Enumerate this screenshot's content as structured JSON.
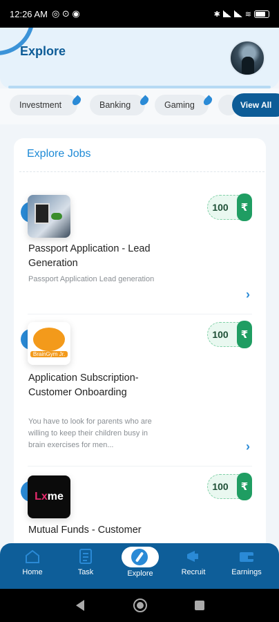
{
  "status": {
    "time": "12:26 AM"
  },
  "header": {
    "title": "Explore"
  },
  "categories": {
    "items": [
      {
        "label": "Investment"
      },
      {
        "label": "Banking"
      },
      {
        "label": "Gaming"
      }
    ],
    "view_all": "View All"
  },
  "jobs": {
    "title": "Explore Jobs",
    "items": [
      {
        "title": "Passport Application - Lead Generation",
        "description": "Passport Application Lead generation",
        "amount": "100",
        "currency": "₹"
      },
      {
        "title": "Application Subscription-Customer Onboarding",
        "description": "You have to look for parents who are willing to keep their children busy in brain exercises for men...",
        "amount": "100",
        "currency": "₹"
      },
      {
        "title": "Mutual Funds - Customer",
        "description": "",
        "amount": "100",
        "currency": "₹"
      }
    ],
    "logo_texts": {
      "brain": "BrainGym Jr.",
      "lxme_left": "L",
      "lxme_x": "x",
      "lxme_right": "me"
    }
  },
  "nav": {
    "items": [
      {
        "label": "Home"
      },
      {
        "label": "Task"
      },
      {
        "label": "Explore"
      },
      {
        "label": "Recruit"
      },
      {
        "label": "Earnings"
      }
    ],
    "active": "Explore"
  }
}
